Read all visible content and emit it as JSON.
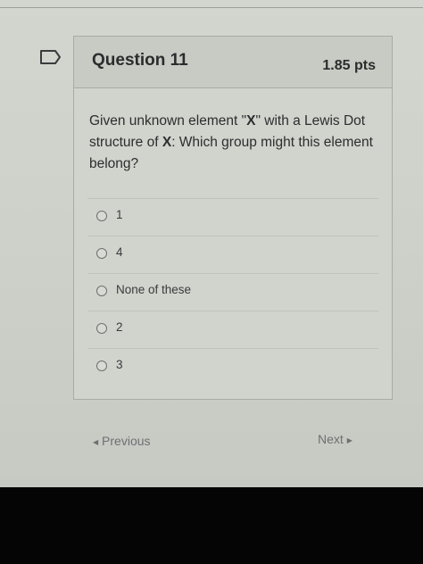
{
  "question": {
    "title": "Question 11",
    "points": "1.85 pts",
    "text_part1": "Given unknown element \"",
    "text_bold1": "X",
    "text_part2": "\" with a Lewis Dot structure of ",
    "text_bold2": "X",
    "text_part3": ": Which group might this element belong?"
  },
  "answers": [
    {
      "label": "1"
    },
    {
      "label": "4"
    },
    {
      "label": "None of these"
    },
    {
      "label": "2"
    },
    {
      "label": "3"
    }
  ],
  "nav": {
    "previous_label": "Previous",
    "next_label": "Next"
  },
  "icons": {
    "flag": "flag-outline-icon",
    "prev_arrow": "triangle-left-icon",
    "next_arrow": "triangle-right-icon"
  }
}
